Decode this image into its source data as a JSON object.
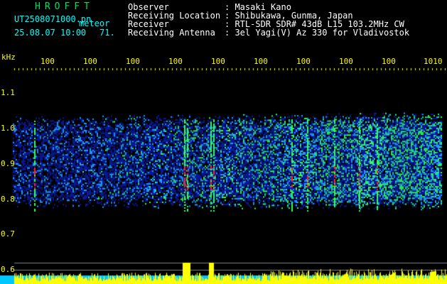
{
  "header": {
    "title": "HROFFT",
    "file_name": "UT2508071000.pn",
    "file_label": "meteor",
    "timestamp": "25.08.07 10:00",
    "value": "71."
  },
  "meta": {
    "observer_label": "Observer",
    "observer_value": ": Masaki Kano",
    "location_label": "Receiving Location",
    "location_value": ": Shibukawa, Gunma, Japan",
    "receiver_label": "Receiver",
    "receiver_value": ": RTL-SDR SDR# 43dB L15 103.2MHz CW",
    "antenna_label": "Receiving Antenna",
    "antenna_value": ": 3el Yagi(V) Az 330 for Vladivostok"
  },
  "axis": {
    "unit": "kHz",
    "y_ticks": [
      "1.1",
      "1.0",
      "0.9",
      "0.8",
      "0.7",
      "0.6"
    ],
    "x_ticks": [
      "100",
      "100",
      "100",
      "100",
      "100",
      "100",
      "100",
      "100",
      "100",
      "1010"
    ]
  },
  "colors": {
    "background": "#000000",
    "header_title": "#00e060",
    "header_text": "#00ffff",
    "meta_text": "#ffffff",
    "axis_text": "#ffff00",
    "signal_low": "#0a1aa0",
    "signal_mid": "#20a0ff",
    "signal_high": "#30ff60",
    "signal_peak": "#ff2020",
    "level_bar": "#ffff00",
    "baseline": "#00c8ff"
  }
}
